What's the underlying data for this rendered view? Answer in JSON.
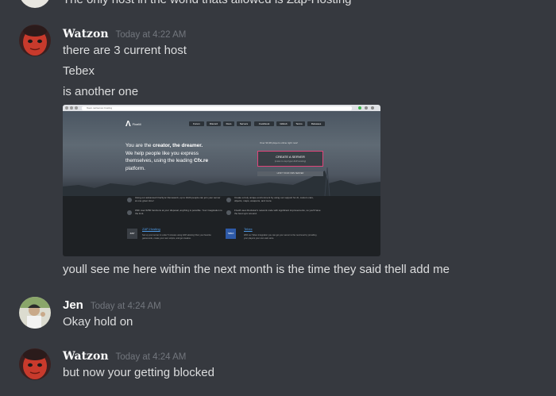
{
  "partial_message": {
    "text": "The only host in the world thats allowed is Zap-Hosting"
  },
  "messages": [
    {
      "author": "Watzon",
      "timestamp": "Today at 4:22 AM",
      "lines": [
        "there are 3 current host",
        "Tebex",
        "is another one"
      ],
      "after_embed": "youll see me here within the next month is the time they said thell add me"
    },
    {
      "author": "Jen",
      "timestamp": "Today at 4:24 AM",
      "lines": [
        "Okay hold on"
      ]
    },
    {
      "author": "Watzon",
      "timestamp": "Today at 4:24 AM",
      "lines": [
        "but now your getting blocked"
      ]
    }
  ],
  "embed": {
    "url": "fivem.net/server-hosting",
    "logo": "FiveM",
    "nav": [
      "Forum",
      "Discord",
      "Docs",
      "Servers",
      "Cookbook",
      "GitHub",
      "Terms",
      "Releases"
    ],
    "headline_1": "You are the ",
    "headline_b1": "creator, the dreamer.",
    "headline_2": "We help people like you express themselves, using the leading ",
    "headline_b2": "Cfx.re",
    "headline_3": " platform.",
    "online": "Over 90,38 players online right now!",
    "cta_title": "CREATE A SERVER",
    "cta_sub": "(Listen to zap-hyper-ZAP-Hosting)",
    "host_own": "HOST YOUR OWN SERVER",
    "features": [
      "Using our advanced OneSync framework, up to 1024 people can join your server at one given time!",
      "Create a truly unique environment by using our support for AI, custom cars, objects, maps, weapons, and more.",
      "With over 6250 functions at your disposal, anything is possible. Your imagination is the limit.",
      "FiveM uses Rockstar's network code with significant improvements, so you'll have the best sync around."
    ],
    "partners": [
      {
        "name": "ZAP-Hosting",
        "badge": "ZAP",
        "desc": "Set up your server in under 5 minutes using ZAP-Hosting! Run your favorite gamemode, create your own scripts, and get creative."
      },
      {
        "name": "Tebex",
        "badge": "TEBEX",
        "desc": "With our Tebex integration you can get your server to the next level by providing your players your own web store."
      }
    ]
  },
  "colors": {
    "background": "#36393f",
    "text": "#dcddde",
    "username": "#ffffff",
    "timestamp": "#72767d",
    "cta_border": "#e0457b",
    "link": "#4f9be8"
  }
}
